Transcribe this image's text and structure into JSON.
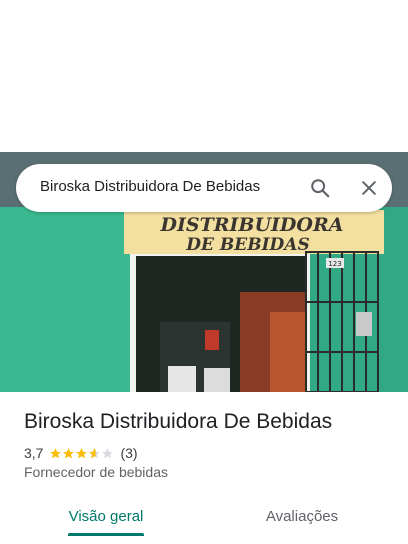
{
  "search": {
    "query": "Biroska Distribuidora De Bebidas"
  },
  "icons": {
    "search": "search-icon",
    "close": "close-icon"
  },
  "photo": {
    "sign_line1": "DISTRIBUIDORA",
    "sign_line2": "DE BEBIDAS",
    "house_number": "123"
  },
  "place": {
    "name": "Biroska Distribuidora De Bebidas",
    "rating": "3,7",
    "rating_value": 3.7,
    "reviews_count": "(3)",
    "category": "Fornecedor de bebidas"
  },
  "tabs": [
    {
      "label": "Visão geral",
      "active": true
    },
    {
      "label": "Avaliações",
      "active": false
    }
  ],
  "colors": {
    "accent": "#00796b",
    "star": "#fbbc04",
    "star_empty": "#dadce0"
  }
}
